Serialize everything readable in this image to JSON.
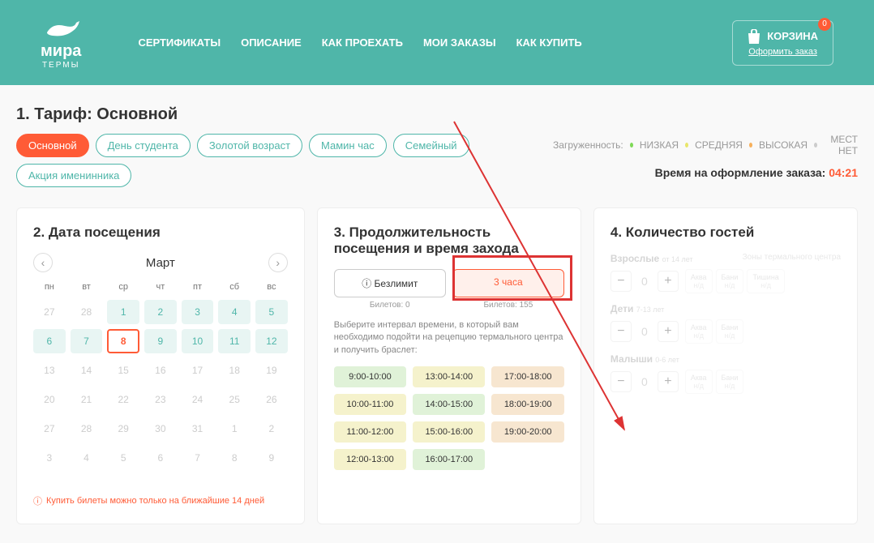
{
  "header": {
    "brand": "мира",
    "brand_sub": "ТЕРМЫ",
    "nav": [
      "СЕРТИФИКАТЫ",
      "ОПИСАНИЕ",
      "КАК ПРОЕХАТЬ",
      "МОИ ЗАКАЗЫ",
      "КАК КУПИТЬ"
    ],
    "cart_label": "КОРЗИНА",
    "cart_count": "0",
    "checkout_link": "Оформить заказ"
  },
  "tariff": {
    "title": "1. Тариф: Основной",
    "pills": [
      "Основной",
      "День студента",
      "Золотой возраст",
      "Мамин час",
      "Семейный",
      "Акция именинника"
    ]
  },
  "load": {
    "label": "Загруженность:",
    "low": "НИЗКАЯ",
    "mid": "СРЕДНЯЯ",
    "hi": "ВЫСОКАЯ",
    "none": "МЕСТ НЕТ"
  },
  "timer": {
    "label": "Время на оформление заказа:",
    "value": "04:21"
  },
  "calendar": {
    "title": "2. Дата посещения",
    "month": "Март",
    "dow": [
      "пн",
      "вт",
      "ср",
      "чт",
      "пт",
      "сб",
      "вс"
    ],
    "days": [
      {
        "n": "27",
        "c": "dim"
      },
      {
        "n": "28",
        "c": "dim"
      },
      {
        "n": "1",
        "c": "avail"
      },
      {
        "n": "2",
        "c": "avail"
      },
      {
        "n": "3",
        "c": "avail"
      },
      {
        "n": "4",
        "c": "avail"
      },
      {
        "n": "5",
        "c": "avail"
      },
      {
        "n": "6",
        "c": "avail"
      },
      {
        "n": "7",
        "c": "avail"
      },
      {
        "n": "8",
        "c": "sel"
      },
      {
        "n": "9",
        "c": "avail"
      },
      {
        "n": "10",
        "c": "avail"
      },
      {
        "n": "11",
        "c": "avail"
      },
      {
        "n": "12",
        "c": "avail"
      },
      {
        "n": "13",
        "c": "dim"
      },
      {
        "n": "14",
        "c": "dim"
      },
      {
        "n": "15",
        "c": "dim"
      },
      {
        "n": "16",
        "c": "dim"
      },
      {
        "n": "17",
        "c": "dim"
      },
      {
        "n": "18",
        "c": "dim"
      },
      {
        "n": "19",
        "c": "dim"
      },
      {
        "n": "20",
        "c": "dim"
      },
      {
        "n": "21",
        "c": "dim"
      },
      {
        "n": "22",
        "c": "dim"
      },
      {
        "n": "23",
        "c": "dim"
      },
      {
        "n": "24",
        "c": "dim"
      },
      {
        "n": "25",
        "c": "dim"
      },
      {
        "n": "26",
        "c": "dim"
      },
      {
        "n": "27",
        "c": "dim"
      },
      {
        "n": "28",
        "c": "dim"
      },
      {
        "n": "29",
        "c": "dim"
      },
      {
        "n": "30",
        "c": "dim"
      },
      {
        "n": "31",
        "c": "dim"
      },
      {
        "n": "1",
        "c": "dim"
      },
      {
        "n": "2",
        "c": "dim"
      },
      {
        "n": "3",
        "c": "dim"
      },
      {
        "n": "4",
        "c": "dim"
      },
      {
        "n": "5",
        "c": "dim"
      },
      {
        "n": "6",
        "c": "dim"
      },
      {
        "n": "7",
        "c": "dim"
      },
      {
        "n": "8",
        "c": "dim"
      },
      {
        "n": "9",
        "c": "dim"
      }
    ],
    "note": "Купить билеты можно только на ближайшие 14 дней"
  },
  "duration": {
    "title": "3. Продолжительность посещения и время захода",
    "opts": [
      {
        "label": "Безлимит",
        "tix": "Билетов: 0"
      },
      {
        "label": "3 часа",
        "tix": "Билетов: 155"
      }
    ],
    "desc": "Выберите интервал времени, в который вам необходимо подойти на рецепцию термального центра и получить браслет:",
    "slots": [
      {
        "t": "9:00-10:00",
        "c": "low"
      },
      {
        "t": "13:00-14:00",
        "c": "mid"
      },
      {
        "t": "17:00-18:00",
        "c": "hi"
      },
      {
        "t": "10:00-11:00",
        "c": "mid"
      },
      {
        "t": "14:00-15:00",
        "c": "low"
      },
      {
        "t": "18:00-19:00",
        "c": "hi"
      },
      {
        "t": "11:00-12:00",
        "c": "mid"
      },
      {
        "t": "15:00-16:00",
        "c": "mid"
      },
      {
        "t": "19:00-20:00",
        "c": "hi"
      },
      {
        "t": "12:00-13:00",
        "c": "mid"
      },
      {
        "t": "16:00-17:00",
        "c": "low"
      }
    ]
  },
  "guests": {
    "title": "4. Количество гостей",
    "zones_title": "Зоны термального центра",
    "rows": [
      {
        "label": "Взрослые",
        "age": "от 14 лет",
        "val": "0",
        "zones": [
          "Аква",
          "Бани",
          "Тишина"
        ]
      },
      {
        "label": "Дети",
        "age": "7-13 лет",
        "val": "0",
        "zones": [
          "Аква",
          "Бани"
        ]
      },
      {
        "label": "Малыши",
        "age": "0-6 лет",
        "val": "0",
        "zones": [
          "Аква",
          "Бани"
        ]
      }
    ],
    "na": "н/д"
  }
}
